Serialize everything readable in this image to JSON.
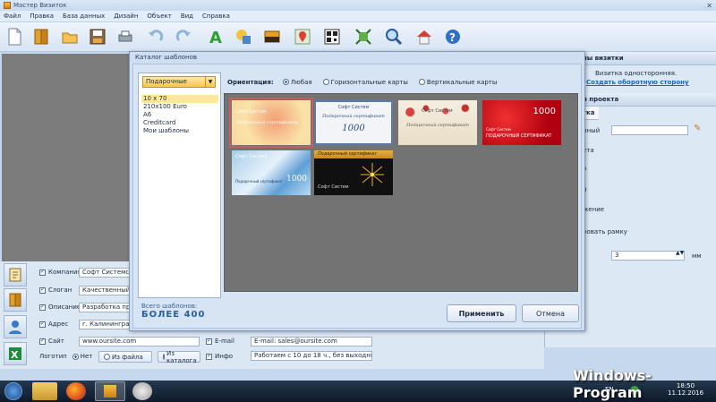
{
  "window": {
    "title": "Мастер Визиток",
    "close": "✕"
  },
  "menu": [
    "Файл",
    "Правка",
    "База данных",
    "Дизайн",
    "Объект",
    "Вид",
    "Справка"
  ],
  "right_panel": {
    "header1": "ны визитки",
    "single_side": "Визитка односторонняя.",
    "create_back": "Создать оборотную сторону",
    "header2": "н проекта",
    "tab": "тка",
    "labels": [
      "нный",
      "ета",
      "а",
      "й",
      "жение",
      "ровать рамку"
    ],
    "spin_value": "3",
    "unit": "мм"
  },
  "form": {
    "rows": [
      {
        "label": "Компания",
        "value": "Софт Системс"
      },
      {
        "label": "Слоган",
        "value": "Качественный соф"
      },
      {
        "label": "Описание",
        "value": "Разработка програ"
      },
      {
        "label": "Адрес",
        "value": "г. Калининград, ул"
      },
      {
        "label": "Сайт",
        "value": "www.oursite.com"
      }
    ],
    "email_label": "E-mail",
    "email_value": "E-mail: sales@oursite.com",
    "info_label": "Инфо",
    "info_value": "Работаем с 10 до 18 ч., без выходных",
    "logo_label": "Логотип",
    "logo_none": "Нет",
    "logo_file": "Из файла",
    "logo_catalog": "Из каталога"
  },
  "dialog": {
    "title": "Каталог шаблонов",
    "category": "Подарочные",
    "sizes": [
      "10 x 70",
      "210x100 Euro",
      "A6",
      "Creditcard",
      "Мои шаблоны"
    ],
    "orientation_label": "Ориентация:",
    "orientation_options": [
      "Любая",
      "Горизонтальные карты",
      "Вертикальные карты"
    ],
    "total_label": "Всего шаблонов:",
    "total_value": "БОЛЕЕ 400",
    "apply": "Применить",
    "cancel": "Отмена",
    "cards": [
      {
        "top": "Софт Систем",
        "main": "Подарочный сертификат"
      },
      {
        "top": "Софт Систем",
        "main": "Подарочный сертификат",
        "num": "1000"
      },
      {
        "top": "Софт Систем",
        "main": "Подарочный сертификат"
      },
      {
        "num": "1000",
        "main": "ПОДАРОЧНЫЙ СЕРТИФИКАТ",
        "top": "Софт Систем"
      },
      {
        "top": "Софт Систем",
        "main": "Подарочный сертификат",
        "num": "1000"
      },
      {
        "top": "Подарочный сертификат",
        "main": "Софт Систем"
      }
    ]
  },
  "taskbar": {
    "lang": "EN",
    "time": "18:50",
    "date": "11.12.2016"
  },
  "watermark": "Windows-Program"
}
